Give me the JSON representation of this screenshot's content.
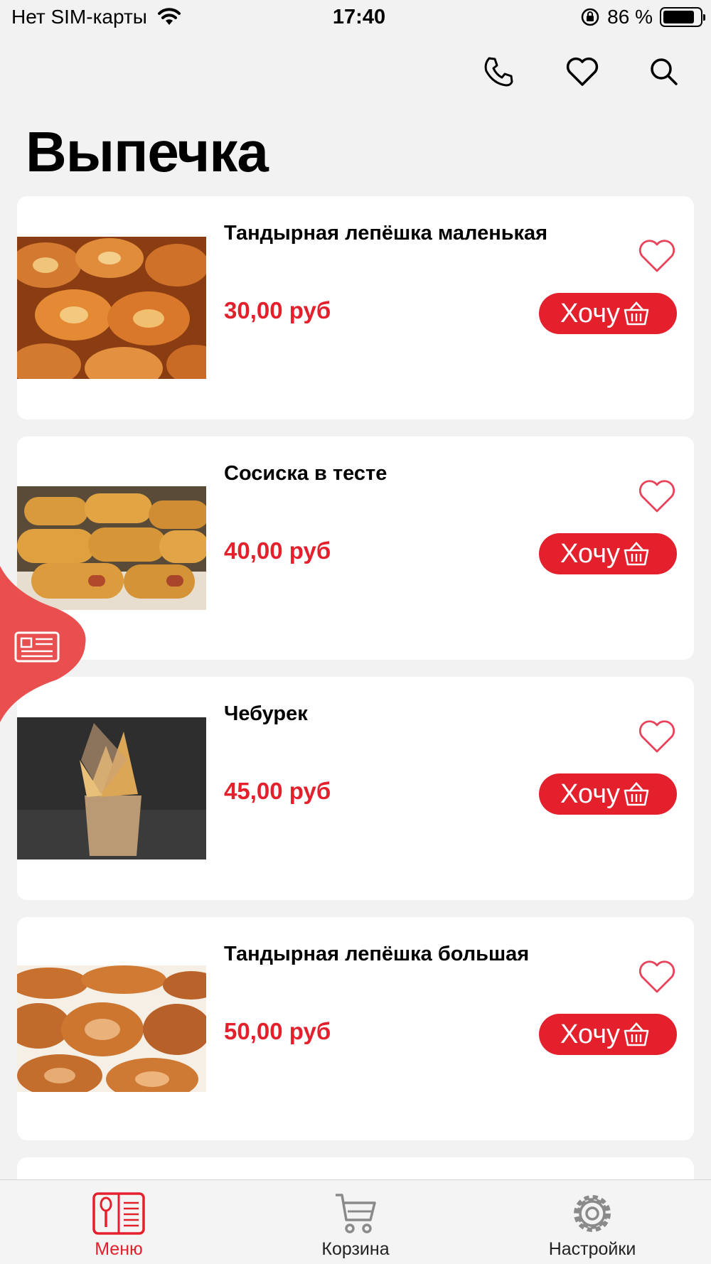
{
  "status_bar": {
    "carrier": "Нет SIM-карты",
    "time": "17:40",
    "battery_percent": "86 %",
    "battery_level": 0.86
  },
  "header": {
    "icons": [
      "phone-icon",
      "heart-icon",
      "search-icon"
    ]
  },
  "page": {
    "title": "Выпечка"
  },
  "products": [
    {
      "name": "Тандырная лепёшка маленькая",
      "price": "30,00 руб",
      "button": "Хочу"
    },
    {
      "name": "Сосиска в тесте",
      "price": "40,00 руб",
      "button": "Хочу"
    },
    {
      "name": "Чебурек",
      "price": "45,00 руб",
      "button": "Хочу"
    },
    {
      "name": "Тандырная лепёшка большая",
      "price": "50,00 руб",
      "button": "Хочу"
    }
  ],
  "tabbar": {
    "items": [
      {
        "label": "Меню",
        "active": true
      },
      {
        "label": "Корзина",
        "active": false
      },
      {
        "label": "Настройки",
        "active": false
      }
    ]
  },
  "colors": {
    "accent": "#e3202c",
    "background": "#f2f2f2",
    "card": "#ffffff"
  }
}
